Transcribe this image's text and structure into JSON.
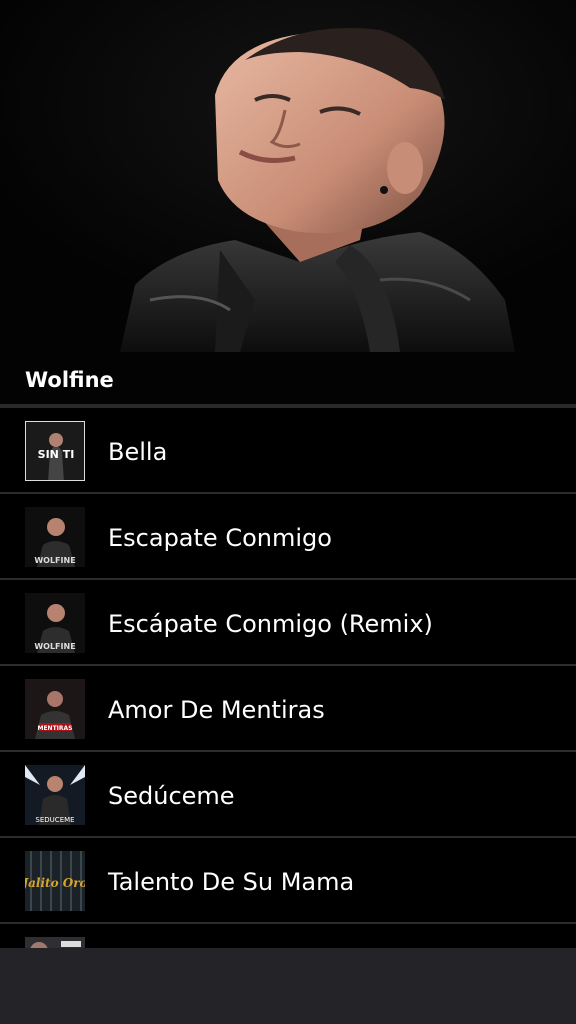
{
  "artist": {
    "name": "Wolfine"
  },
  "songs": [
    {
      "title": "Bella",
      "cover_text": "SIN TI"
    },
    {
      "title": "Escapate Conmigo",
      "cover_text": "WOLFINE"
    },
    {
      "title": "Escápate Conmigo (Remix)",
      "cover_text": "WOLFINE"
    },
    {
      "title": "Amor De Mentiras",
      "cover_text": "MENTIRAS"
    },
    {
      "title": "Sedúceme",
      "cover_text": "SEDUCEME"
    },
    {
      "title": "Talento De Su Mama",
      "cover_text": "Jalito Oro"
    }
  ],
  "colors": {
    "background": "#000000",
    "divider": "#2c2c2c",
    "bottom_bar": "#242428",
    "text": "#ffffff"
  }
}
